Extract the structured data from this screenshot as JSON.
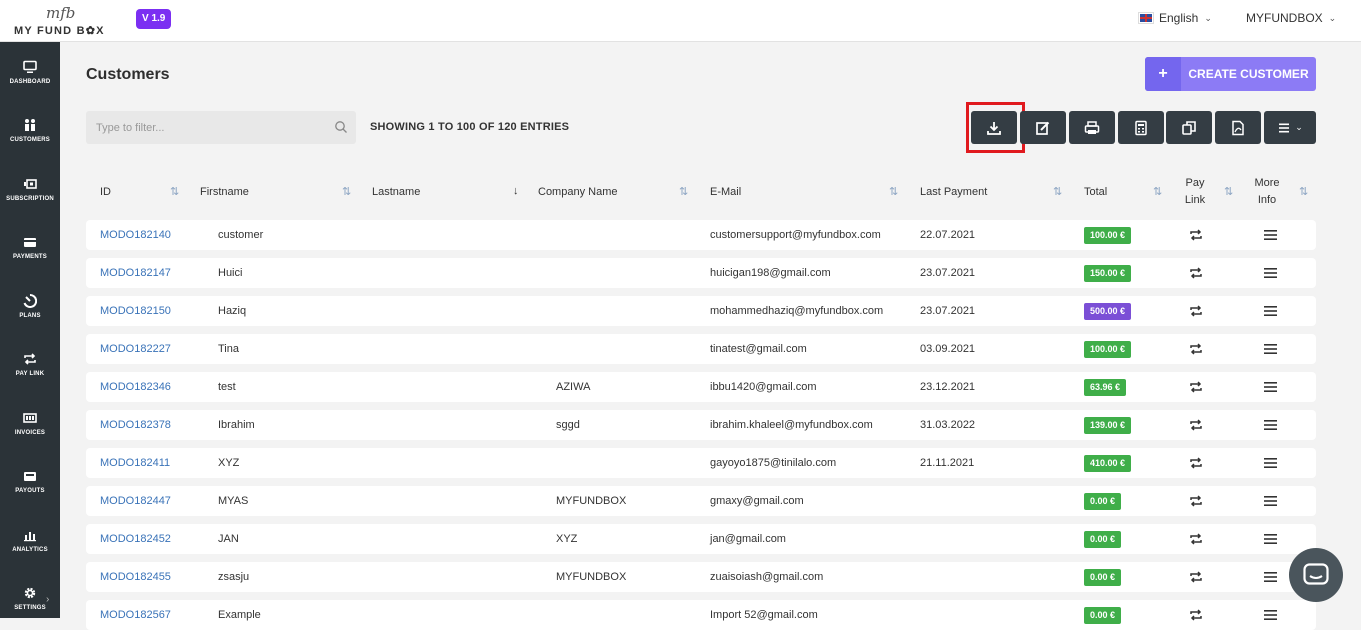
{
  "topbar": {
    "logo_mark": "mfb",
    "logo_text": "MY FUND B✿X",
    "version": "V 1.9",
    "language": "English",
    "user": "MYFUNDBOX"
  },
  "sidebar": {
    "items": [
      {
        "label": "DASHBOARD",
        "icon": "monitor-icon"
      },
      {
        "label": "CUSTOMERS",
        "icon": "users-icon"
      },
      {
        "label": "SUBSCRIPTION",
        "icon": "subscription-icon"
      },
      {
        "label": "PAYMENTS",
        "icon": "credit-card-icon"
      },
      {
        "label": "PLANS",
        "icon": "plans-icon"
      },
      {
        "label": "PAY LINK",
        "icon": "repeat-icon"
      },
      {
        "label": "INVOICES",
        "icon": "invoice-icon"
      },
      {
        "label": "PAYOUTS",
        "icon": "wallet-icon"
      },
      {
        "label": "ANALYTICS",
        "icon": "bar-chart-icon"
      },
      {
        "label": "SETTINGS",
        "icon": "gear-icon"
      }
    ]
  },
  "page": {
    "title": "Customers",
    "create_button": "CREATE CUSTOMER",
    "filter_placeholder": "Type to filter...",
    "showing": "SHOWING 1 TO 100 OF 120 ENTRIES"
  },
  "toolbar": [
    "download-icon",
    "edit-icon",
    "print-icon",
    "calculator-icon",
    "copy-icon",
    "pdf-icon",
    "list-menu-icon"
  ],
  "table": {
    "headers": {
      "id": "ID",
      "firstname": "Firstname",
      "lastname": "Lastname",
      "company": "Company Name",
      "email": "E-Mail",
      "last_payment": "Last Payment",
      "total": "Total",
      "pay_link_1": "Pay",
      "pay_link_2": "Link",
      "more_info_1": "More",
      "more_info_2": "Info"
    },
    "rows": [
      {
        "id": "MODO182140",
        "firstname": "customer",
        "company": "",
        "email": "customersupport@myfundbox.com",
        "last_payment": "22.07.2021",
        "total": "100.00 €",
        "color": "#3fae49"
      },
      {
        "id": "MODO182147",
        "firstname": "Huici",
        "company": "",
        "email": "huicigan198@gmail.com",
        "last_payment": "23.07.2021",
        "total": "150.00 €",
        "color": "#3fae49"
      },
      {
        "id": "MODO182150",
        "firstname": "Haziq",
        "company": "",
        "email": "mohammedhaziq@myfundbox.com",
        "last_payment": "23.07.2021",
        "total": "500.00 €",
        "color": "#7b4fd6"
      },
      {
        "id": "MODO182227",
        "firstname": "Tina",
        "company": "",
        "email": "tinatest@gmail.com",
        "last_payment": "03.09.2021",
        "total": "100.00 €",
        "color": "#3fae49"
      },
      {
        "id": "MODO182346",
        "firstname": "test",
        "company": "AZIWA",
        "email": "ibbu1420@gmail.com",
        "last_payment": "23.12.2021",
        "total": "63.96 €",
        "color": "#3fae49"
      },
      {
        "id": "MODO182378",
        "firstname": "Ibrahim",
        "company": "sggd",
        "email": "ibrahim.khaleel@myfundbox.com",
        "last_payment": "31.03.2022",
        "total": "139.00 €",
        "color": "#3fae49"
      },
      {
        "id": "MODO182411",
        "firstname": "XYZ",
        "company": "",
        "email": "gayoyo1875@tinilalo.com",
        "last_payment": "21.11.2021",
        "total": "410.00 €",
        "color": "#3fae49"
      },
      {
        "id": "MODO182447",
        "firstname": "MYAS",
        "company": "MYFUNDBOX",
        "email": "gmaxy@gmail.com",
        "last_payment": "",
        "total": "0.00 €",
        "color": "#3fae49"
      },
      {
        "id": "MODO182452",
        "firstname": "JAN",
        "company": "XYZ",
        "email": "jan@gmail.com",
        "last_payment": "",
        "total": "0.00 €",
        "color": "#3fae49"
      },
      {
        "id": "MODO182455",
        "firstname": "zsasju",
        "company": "MYFUNDBOX",
        "email": "zuaisoiash@gmail.com",
        "last_payment": "",
        "total": "0.00 €",
        "color": "#3fae49"
      },
      {
        "id": "MODO182567",
        "firstname": "Example",
        "company": "",
        "email": "Import 52@gmail.com",
        "last_payment": "",
        "total": "0.00 €",
        "color": "#3fae49"
      }
    ]
  }
}
